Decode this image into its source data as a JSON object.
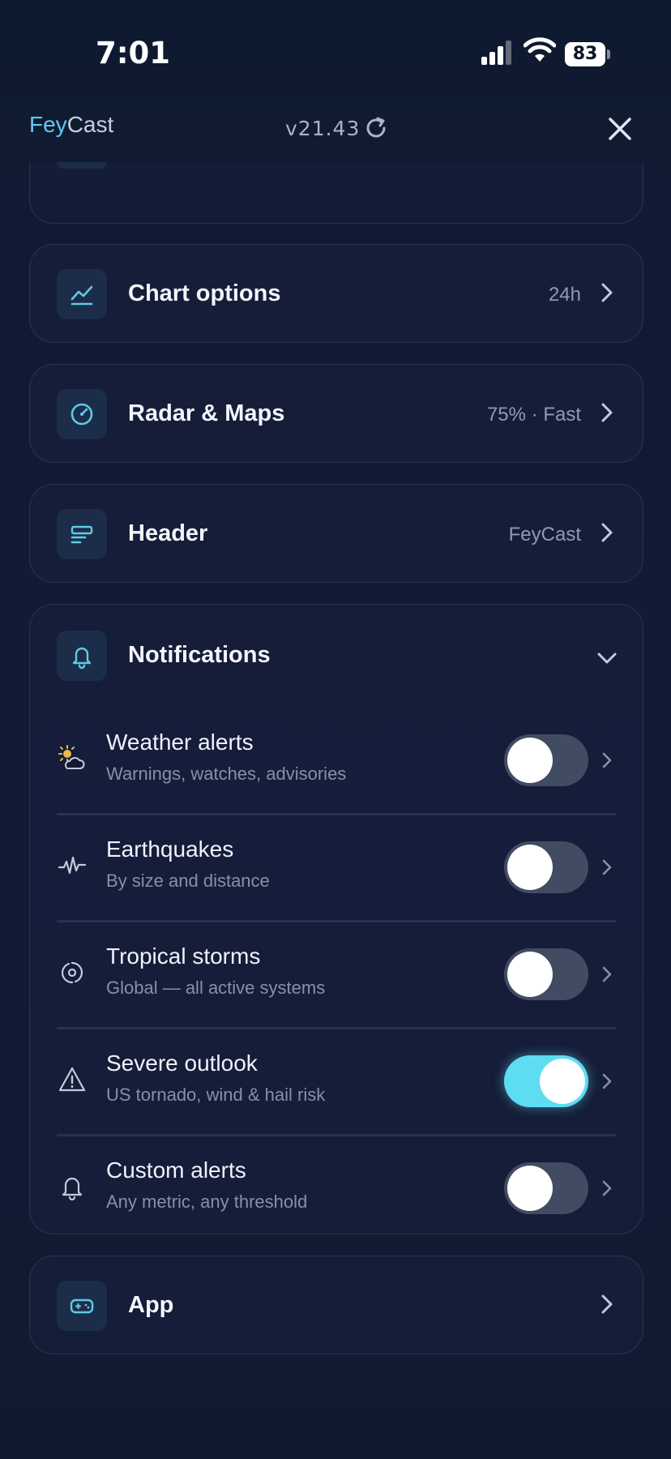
{
  "status": {
    "time": "7:01",
    "battery": "83"
  },
  "header": {
    "brand_prefix": "Fey",
    "brand_suffix": "Cast",
    "version": "v21.43"
  },
  "rows": [
    {
      "title": "Chart options",
      "value": "24h",
      "icon": "chart-line-icon"
    },
    {
      "title": "Radar & Maps",
      "value": "75% · Fast",
      "icon": "gauge-icon"
    },
    {
      "title": "Header",
      "value": "FeyCast",
      "icon": "text-lines-icon"
    }
  ],
  "notifications": {
    "title": "Notifications",
    "items": [
      {
        "title": "Weather alerts",
        "subtitle": "Warnings, watches, advisories",
        "enabled": false,
        "icon": "partly-cloudy-icon"
      },
      {
        "title": "Earthquakes",
        "subtitle": "By size and distance",
        "enabled": false,
        "icon": "seismic-wave-icon"
      },
      {
        "title": "Tropical storms",
        "subtitle": "Global — all active systems",
        "enabled": false,
        "icon": "hurricane-icon"
      },
      {
        "title": "Severe outlook",
        "subtitle": "US tornado, wind & hail risk",
        "enabled": true,
        "icon": "warning-triangle-icon"
      },
      {
        "title": "Custom alerts",
        "subtitle": "Any metric, any threshold",
        "enabled": false,
        "icon": "bell-icon"
      }
    ]
  },
  "app": {
    "title": "App"
  },
  "colors": {
    "accent": "#5ddcf2",
    "background": "#121a35",
    "card_border": "#283553"
  }
}
